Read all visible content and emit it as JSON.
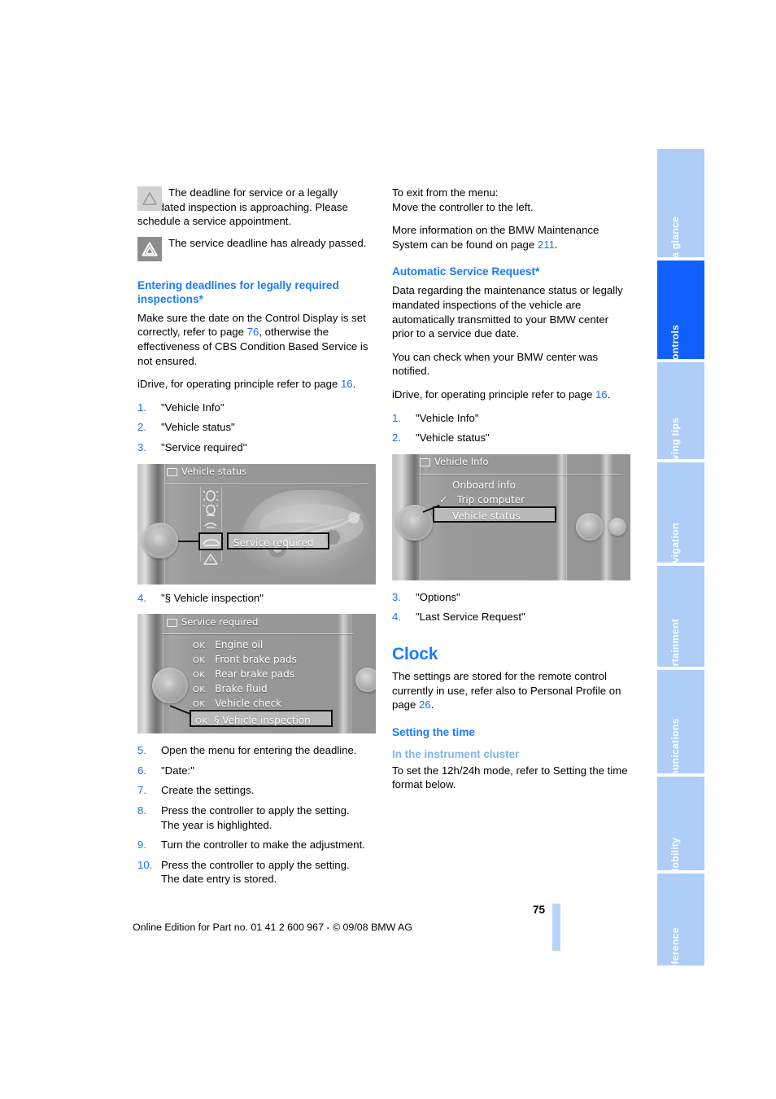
{
  "page": {
    "number": "75",
    "footer_line": "Online Edition for Part no. 01 41 2 600 967  - © 09/08 BMW AG"
  },
  "colors": {
    "link_blue": "#1a6dff",
    "heading_blue": "#1a7bff",
    "subheading_blue": "#7fb5f5",
    "tab_inactive": "#aecdf7",
    "tab_active": "#1060ff",
    "footer_bar": "#b9d4fa"
  },
  "left_column": {
    "notes": [
      {
        "icon": "warning-triangle-light-icon",
        "text": "The deadline for service or a legally mandated inspection is approaching. Please schedule a service appointment."
      },
      {
        "icon": "warning-triangle-dark-icon",
        "text": "The service deadline has already passed."
      }
    ],
    "heading": "Entering deadlines for legally required inspections*",
    "intro_before_ref": "Make sure the date on the Control Display is set correctly, refer to page ",
    "intro_ref": "76",
    "intro_after_ref": ", otherwise the effectiveness of CBS Condition Based Service is not ensured.",
    "idrive_before_ref": "iDrive, for operating principle refer to page ",
    "idrive_ref": "16",
    "idrive_after_ref": ".",
    "steps_1to3": [
      {
        "num": "1.",
        "text": "\"Vehicle Info\""
      },
      {
        "num": "2.",
        "text": "\"Vehicle status\""
      },
      {
        "num": "3.",
        "text": "\"Service required\""
      }
    ],
    "screenshot_vehicle_status": {
      "title": "Vehicle status",
      "title_icon": "display-screen-icon",
      "selected_item": "Service required",
      "status_icons": [
        "tire-pressure-icon",
        "tire-pressure-flat-icon",
        "lamp-icon",
        "car-icon",
        "warning-triangle-icon"
      ]
    },
    "step_4": {
      "num": "4.",
      "text": "\"§ Vehicle inspection\""
    },
    "screenshot_service_required": {
      "title": "Service required",
      "title_icon": "display-screen-icon",
      "ok_label": "OK",
      "items": [
        "Engine oil",
        "Front brake pads",
        "Rear brake pads",
        "Brake fluid",
        "Vehicle check"
      ],
      "selected_item": "§ Vehicle inspection"
    },
    "steps_5to10": [
      {
        "num": "5.",
        "text": "Open the menu for entering the deadline.",
        "sub": ""
      },
      {
        "num": "6.",
        "text": "\"Date:\"",
        "sub": ""
      },
      {
        "num": "7.",
        "text": "Create the settings.",
        "sub": ""
      },
      {
        "num": "8.",
        "text": "Press the controller to apply the setting.",
        "sub": "The year is highlighted."
      },
      {
        "num": "9.",
        "text": "Turn the controller to make the adjustment.",
        "sub": ""
      },
      {
        "num": "10.",
        "text": "Press the controller to apply the setting.",
        "sub": "The date entry is stored."
      }
    ]
  },
  "right_column": {
    "exit_line1": "To exit from the menu:",
    "exit_line2": "Move the controller to the left.",
    "more_info_before_ref": "More information on the BMW Maintenance System can be found on page ",
    "more_info_ref": "211",
    "more_info_after_ref": ".",
    "heading_asr": "Automatic Service Request*",
    "asr_para1": "Data regarding the maintenance status or legally mandated inspections of the vehicle are automatically transmitted to your BMW center prior to a service due date.",
    "asr_para2": "You can check when your BMW center was notified.",
    "idrive_before_ref": "iDrive, for operating principle refer to page ",
    "idrive_ref": "16",
    "idrive_after_ref": ".",
    "steps_1to2": [
      {
        "num": "1.",
        "text": "\"Vehicle Info\""
      },
      {
        "num": "2.",
        "text": "\"Vehicle status\""
      }
    ],
    "screenshot_vehicle_info": {
      "title": "Vehicle Info",
      "title_icon": "display-screen-icon",
      "items": [
        {
          "label": "Onboard info",
          "checked": false,
          "selected": false
        },
        {
          "label": "Trip computer",
          "checked": true,
          "selected": false
        },
        {
          "label": "Vehicle status",
          "checked": false,
          "selected": true
        }
      ],
      "check_glyph": "✓"
    },
    "steps_3to4": [
      {
        "num": "3.",
        "text": "\"Options\""
      },
      {
        "num": "4.",
        "text": "\"Last Service Request\""
      }
    ],
    "heading_clock": "Clock",
    "clock_before_ref": "The settings are stored for the remote control currently in use, refer also to Personal Profile on page ",
    "clock_ref": "26",
    "clock_after_ref": ".",
    "heading_setting_time": "Setting the time",
    "subheading_cluster": "In the instrument cluster",
    "cluster_text": "To set the 12h/24h mode, refer to Setting the time format below."
  },
  "side_tabs": [
    {
      "label": "At a glance",
      "active": false
    },
    {
      "label": "Controls",
      "active": true
    },
    {
      "label": "Driving tips",
      "active": false
    },
    {
      "label": "Navigation",
      "active": false
    },
    {
      "label": "Entertainment",
      "active": false
    },
    {
      "label": "Communications",
      "active": false
    },
    {
      "label": "Mobility",
      "active": false
    },
    {
      "label": "Reference",
      "active": false
    }
  ]
}
